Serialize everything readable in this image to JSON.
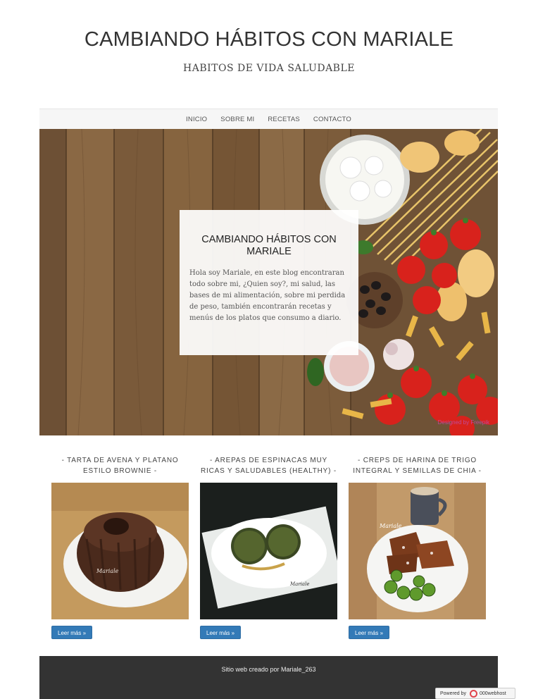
{
  "header": {
    "title": "CAMBIANDO HÁBITOS CON MARIALE",
    "tagline": "HABITOS DE VIDA SALUDABLE"
  },
  "nav": {
    "items": [
      {
        "label": "INICIO"
      },
      {
        "label": "SOBRE MI"
      },
      {
        "label": "RECETAS"
      },
      {
        "label": "CONTACTO"
      }
    ]
  },
  "hero": {
    "card_title": "CAMBIANDO HÁBITOS CON MARIALE",
    "card_text": "Hola soy Mariale, en este blog encontraran todo sobre mi, ¿Quien soy?, mi salud, las bases de mi alimentación, sobre mi perdida de peso, también encontrarán recetas y menús de los platos que consumo a diario.",
    "photo_credit": "Designed by Freepik"
  },
  "posts": [
    {
      "title": "- TARTA DE AVENA Y PLATANO ESTILO BROWNIE -",
      "read_more": "Leer más »",
      "watermark": "Mariale"
    },
    {
      "title": "- AREPAS DE ESPINACAS MUY RICAS Y SALUDABLES (HEALTHY) -",
      "read_more": "Leer más »",
      "watermark": "Mariale"
    },
    {
      "title": "- CREPS DE HARINA DE TRIGO INTEGRAL Y SEMILLAS DE CHIA -",
      "read_more": "Leer más »",
      "watermark": "Mariale"
    }
  ],
  "footer": {
    "text": "Sitio web creado por Mariale_263"
  },
  "badge": {
    "powered": "Powered by",
    "brand": "000webhost"
  },
  "colors": {
    "button": "#337ab7",
    "footer_bg": "#333333",
    "nav_bg": "#f6f6f6"
  }
}
